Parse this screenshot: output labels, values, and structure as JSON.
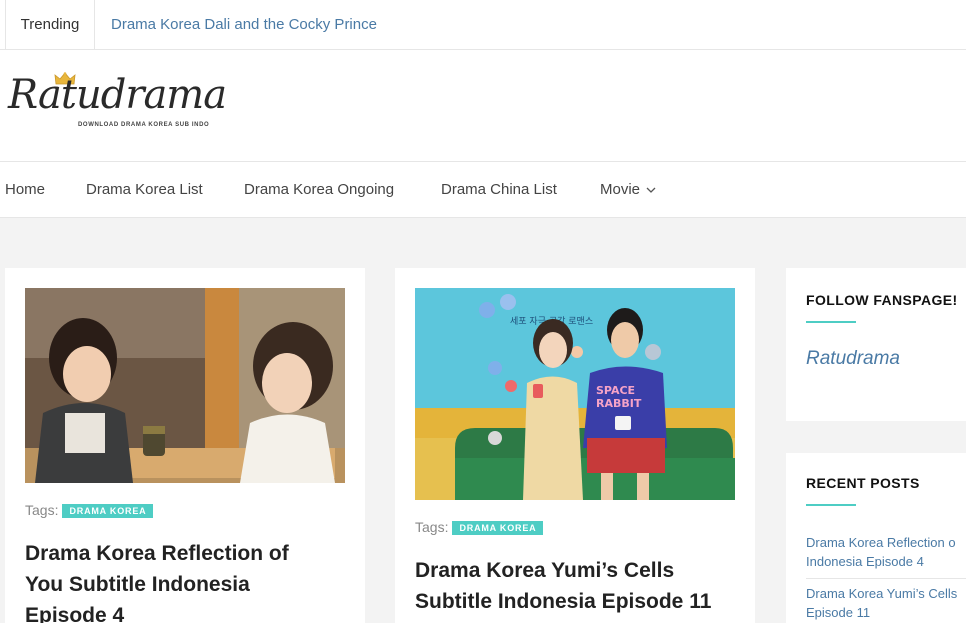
{
  "trending": {
    "label": "Trending",
    "link": "Drama Korea Dali and the Cocky Prince"
  },
  "logo": {
    "name": "Ratudrama",
    "tagline": "DOWNLOAD DRAMA KOREA SUB INDO"
  },
  "nav": {
    "items": [
      "Home",
      "Drama Korea List",
      "Drama Korea Ongoing",
      "Drama China List",
      "Movie"
    ]
  },
  "posts": [
    {
      "tags_label": "Tags:",
      "tag": "DRAMA KOREA",
      "title_line1": "Drama Korea Reflection of",
      "title_line2": "You Subtitle Indonesia",
      "title_line3": "Episode 4"
    },
    {
      "tags_label": "Tags:",
      "tag": "DRAMA KOREA",
      "title_line1": "Drama Korea Yumi’s Cells",
      "title_line2": "Subtitle Indonesia Episode 11",
      "poster_text": "세포 자극 공감 로맨스",
      "shirt_text_1": "SPACE",
      "shirt_text_2": "RABBIT"
    }
  ],
  "sidebar": {
    "follow_title": "FOLLOW FANSPAGE!",
    "fanpage_link": "Ratudrama",
    "recent_title": "RECENT POSTS",
    "recent_posts": [
      {
        "line1": "Drama Korea Reflection o",
        "line2": "Indonesia Episode 4"
      },
      {
        "line1": "Drama Korea Yumi’s Cells",
        "line2": "Episode 11"
      }
    ]
  },
  "colors": {
    "accent": "#4ecdc4",
    "link": "#4a7aa5",
    "background": "#f3f3f3"
  }
}
